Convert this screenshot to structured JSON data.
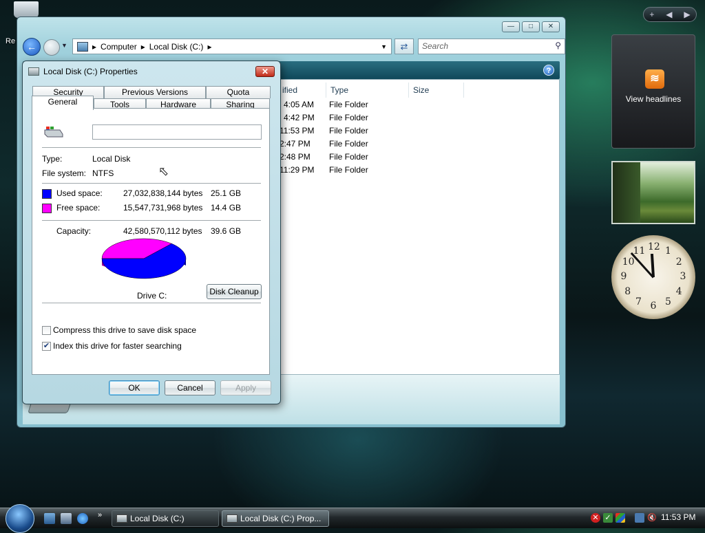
{
  "desktop": {
    "label_re": "Re"
  },
  "explorer": {
    "window_buttons": {
      "minimize": "—",
      "maximize": "□",
      "close": "✕"
    },
    "address": {
      "crumbs": [
        "Computer",
        "Local Disk (C:)"
      ]
    },
    "search_placeholder": "Search",
    "columns": [
      "ified",
      "Type",
      "Size"
    ],
    "rows": [
      {
        "modified": "4:05 AM",
        "type": "File Folder"
      },
      {
        "modified": "4:42 PM",
        "type": "File Folder"
      },
      {
        "modified": "11:53 PM",
        "type": "File Folder"
      },
      {
        "modified": "2:47 PM",
        "type": "File Folder"
      },
      {
        "modified": "2:48 PM",
        "type": "File Folder"
      },
      {
        "modified": "11:29 PM",
        "type": "File Folder"
      }
    ]
  },
  "dialog": {
    "title": "Local Disk (C:) Properties",
    "tabs_top": [
      "Security",
      "Previous Versions",
      "Quota"
    ],
    "tabs_bottom": [
      "General",
      "Tools",
      "Hardware",
      "Sharing"
    ],
    "active_tab": "General",
    "name_value": "",
    "type_label": "Type:",
    "type_value": "Local Disk",
    "fs_label": "File system:",
    "fs_value": "NTFS",
    "used_label": "Used space:",
    "used_bytes": "27,032,838,144 bytes",
    "used_gb": "25.1 GB",
    "free_label": "Free space:",
    "free_bytes": "15,547,731,968 bytes",
    "free_gb": "14.4 GB",
    "capacity_label": "Capacity:",
    "capacity_bytes": "42,580,570,112 bytes",
    "capacity_gb": "39.6 GB",
    "used_fraction": 0.635,
    "colors": {
      "used": "#0000ff",
      "free": "#ff00ff"
    },
    "drive_label": "Drive C:",
    "disk_cleanup": "Disk Cleanup",
    "compress_label": "Compress this drive to save disk space",
    "compress_checked": false,
    "index_label": "Index this drive for faster searching",
    "index_checked": true,
    "ok": "OK",
    "cancel": "Cancel",
    "apply": "Apply"
  },
  "sidebar": {
    "feeds_text": "View headlines",
    "clock": {
      "hour": 11,
      "minute": 53
    }
  },
  "taskbar": {
    "tasks": [
      "Local Disk (C:)",
      "Local Disk (C:) Prop..."
    ],
    "time": "11:53 PM"
  }
}
